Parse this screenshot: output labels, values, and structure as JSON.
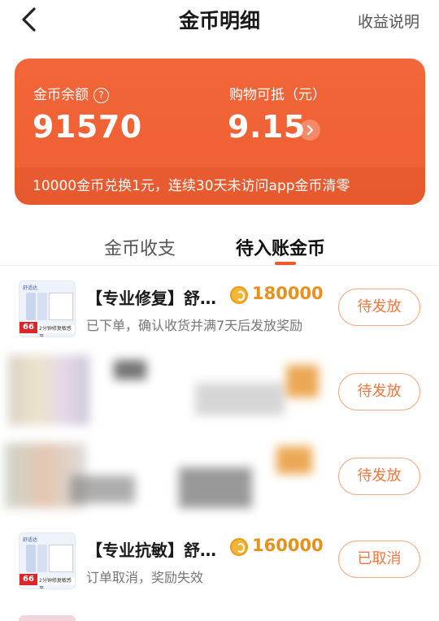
{
  "header": {
    "back_icon": "chevron-left-icon",
    "title": "金币明细",
    "help_link": "收益说明"
  },
  "summary": {
    "balance_label": "金币余额",
    "balance_help_icon": "question-circle-icon",
    "balance_value": "91570",
    "deduct_label": "购物可抵（元）",
    "deduct_value": "9.15",
    "deduct_arrow_icon": "chevron-right-icon",
    "note": "10000金币兑换1元，连续30天未访问app金币清零",
    "accent_color": "#ef5f33"
  },
  "tabs": [
    {
      "label": "金币收支",
      "active": false
    },
    {
      "label": "待入账金币",
      "active": true
    }
  ],
  "records": [
    {
      "title": "【专业修复】舒…",
      "amount": "180000",
      "subtitle": "已下单，确认收货并满7天后发放奖励",
      "status": "待发放",
      "thumb_badge": "66",
      "thumb_caption": "2分钟修复敏感牙"
    },
    {
      "status": "待发放"
    },
    {
      "status": "待发放"
    },
    {
      "title": "【专业抗敏】舒…",
      "amount": "160000",
      "subtitle": "订单取消，奖励失效",
      "status": "已取消",
      "thumb_badge": "66",
      "thumb_caption": "2分钟修复敏感牙"
    }
  ]
}
